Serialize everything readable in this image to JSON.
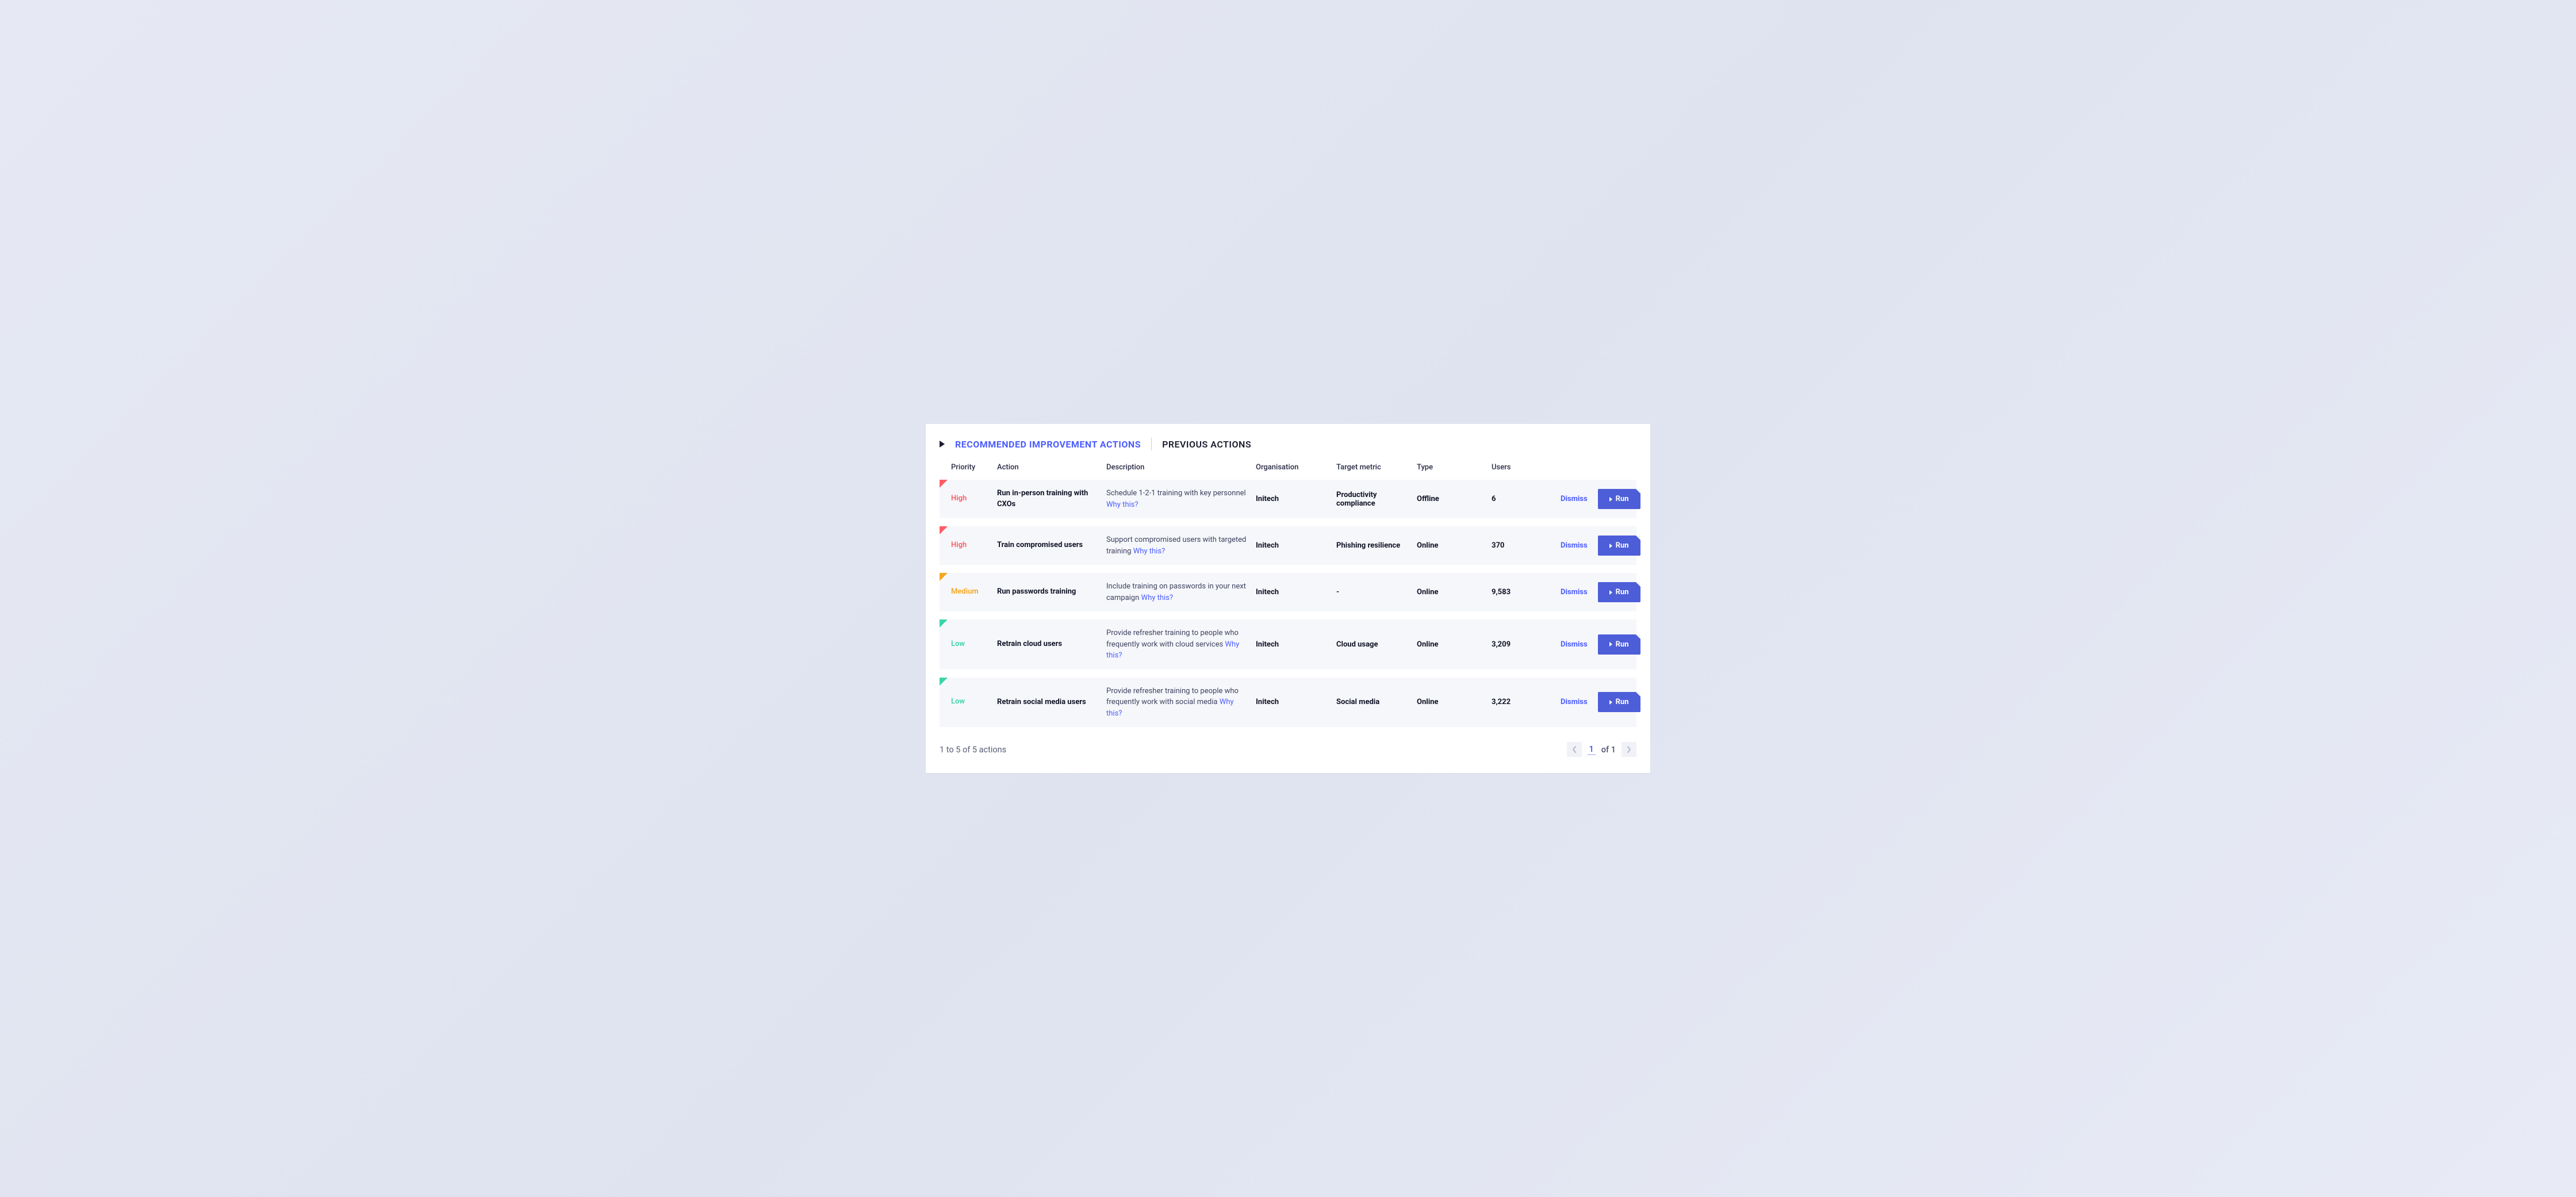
{
  "tabs": {
    "recommended": "RECOMMENDED IMPROVEMENT ACTIONS",
    "previous": "PREVIOUS ACTIONS"
  },
  "columns": {
    "priority": "Priority",
    "action": "Action",
    "description": "Description",
    "organisation": "Organisation",
    "target_metric": "Target metric",
    "type": "Type",
    "users": "Users"
  },
  "why_this": "Why this?",
  "buttons": {
    "dismiss": "Dismiss",
    "run": "Run"
  },
  "rows": [
    {
      "priority": "High",
      "priority_level": "high",
      "action": "Run in-person training with CXOs",
      "description": "Schedule 1-2-1 training with key personnel",
      "organisation": "Initech",
      "target_metric": "Productivity compliance",
      "type": "Offline",
      "users": "6"
    },
    {
      "priority": "High",
      "priority_level": "high",
      "action": "Train compromised users",
      "description": "Support compromised users with targeted training",
      "organisation": "Initech",
      "target_metric": "Phishing resilience",
      "type": "Online",
      "users": "370"
    },
    {
      "priority": "Medium",
      "priority_level": "medium",
      "action": "Run passwords training",
      "description": "Include training on passwords in your next campaign",
      "organisation": "Initech",
      "target_metric": "-",
      "type": "Online",
      "users": "9,583"
    },
    {
      "priority": "Low",
      "priority_level": "low",
      "action": "Retrain cloud users",
      "description": "Provide refresher training to people who frequently work with cloud services",
      "organisation": "Initech",
      "target_metric": "Cloud usage",
      "type": "Online",
      "users": "3,209"
    },
    {
      "priority": "Low",
      "priority_level": "low",
      "action": "Retrain social media users",
      "description": "Provide refresher training to people who frequently work with social media",
      "organisation": "Initech",
      "target_metric": "Social media",
      "type": "Online",
      "users": "3,222"
    }
  ],
  "footer": {
    "count_text": "1 to 5 of 5 actions",
    "page_current": "1",
    "page_of": "of 1"
  }
}
